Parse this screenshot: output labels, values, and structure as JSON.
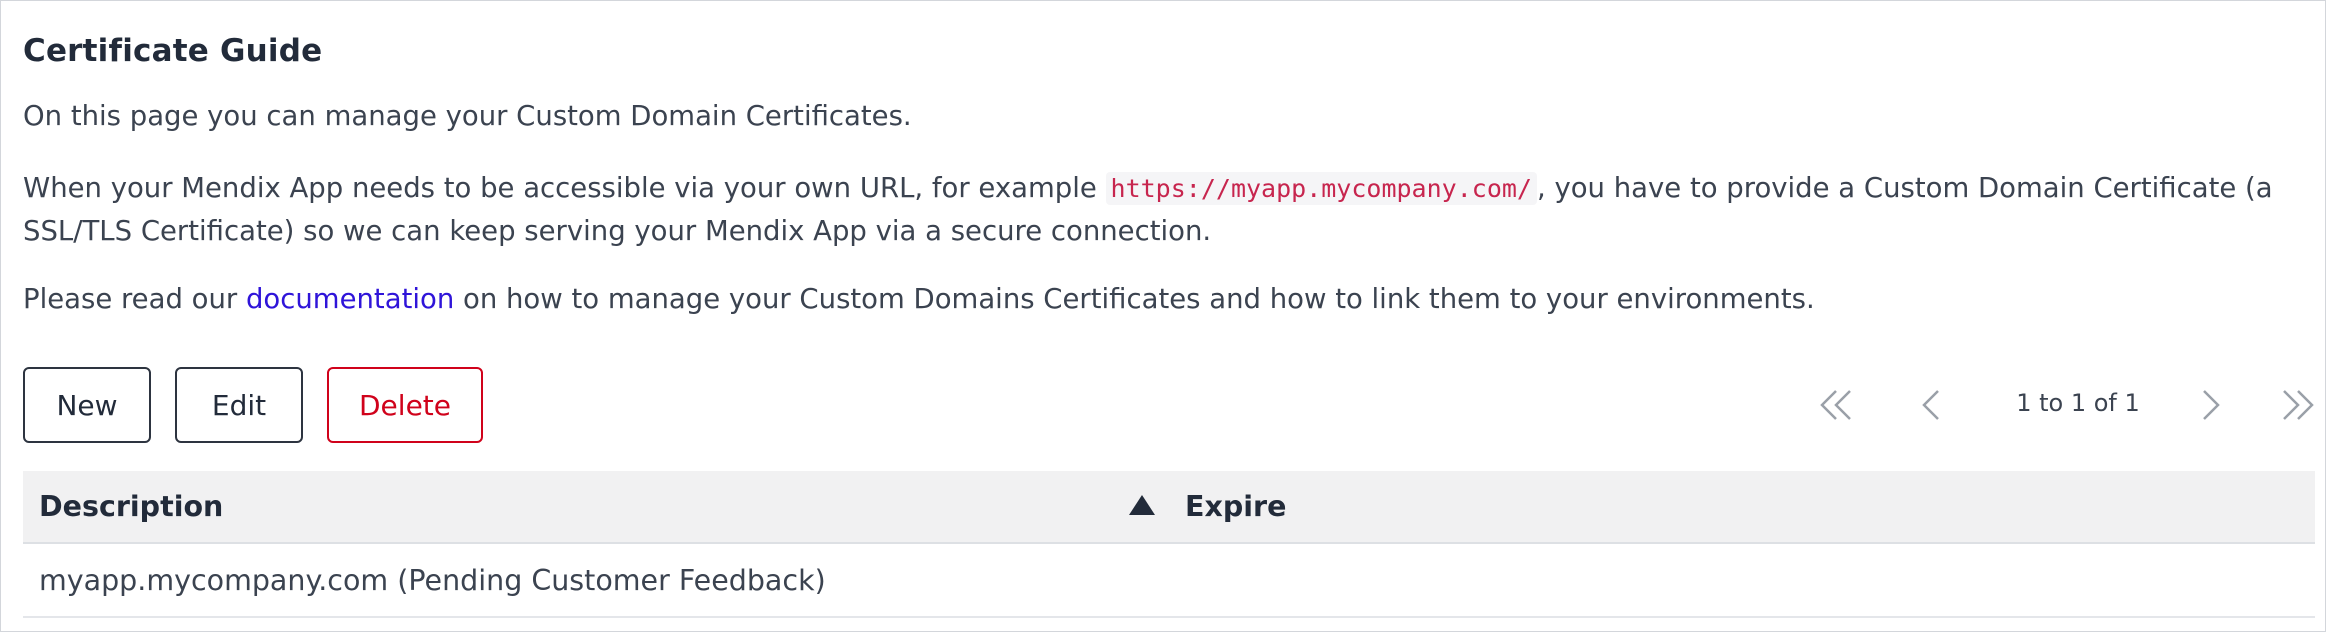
{
  "header": {
    "title": "Certificate Guide"
  },
  "intro": {
    "line1": "On this page you can manage your Custom Domain Certificates.",
    "line2_before": "When your Mendix App needs to be accessible via your own URL, for example ",
    "line2_code": "https://myapp.mycompany.com/",
    "line2_after": ", you have to provide a Custom Domain Certificate (a SSL/TLS Certificate) so we can keep serving your Mendix App via a secure connection.",
    "line3_before": "Please read our ",
    "line3_link": "documentation",
    "line3_after": " on how to manage your Custom Domains Certificates and how to link them to your environments."
  },
  "toolbar": {
    "new_label": "New",
    "edit_label": "Edit",
    "delete_label": "Delete"
  },
  "pagination": {
    "status": "1 to 1 of 1",
    "icons": [
      "first-page-icon",
      "previous-page-icon",
      "next-page-icon",
      "last-page-icon"
    ]
  },
  "table": {
    "columns": [
      "Description",
      "Expire"
    ],
    "sorted_column": "Description",
    "sort_direction": "ascending",
    "rows": [
      {
        "description": "myapp.mycompany.com (Pending Customer Feedback)",
        "expire": ""
      }
    ]
  },
  "colors": {
    "text": "#3b4350",
    "heading": "#222b3a",
    "link": "#2f14d9",
    "code": "#c7254e",
    "danger": "#d0021b",
    "header_bg": "#f1f1f2"
  }
}
